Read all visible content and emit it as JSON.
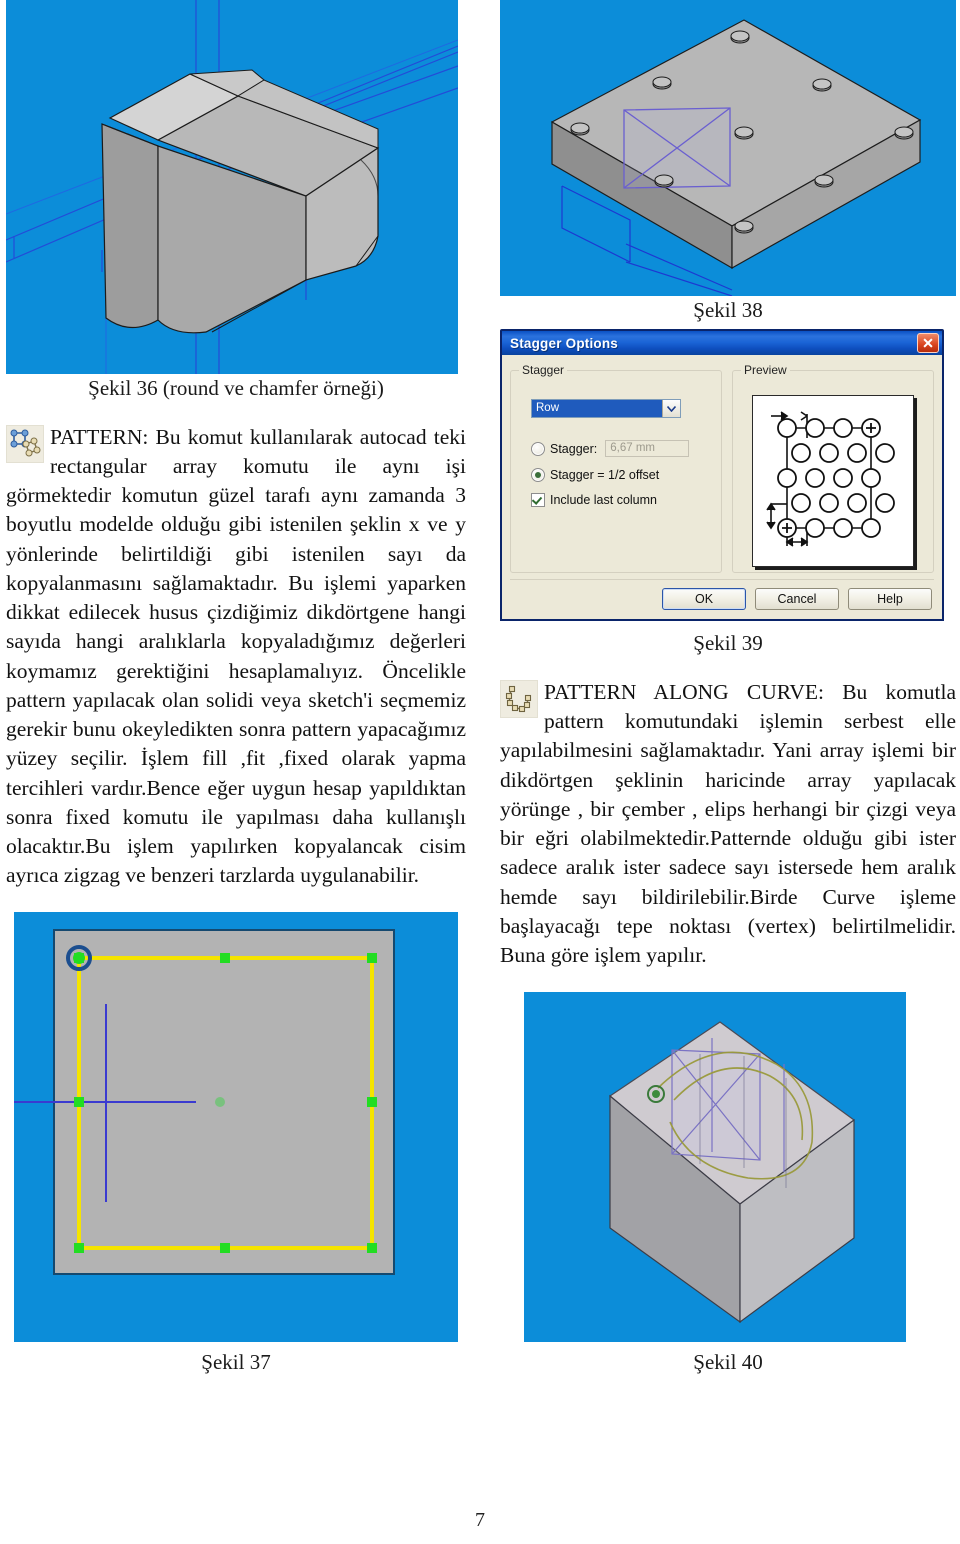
{
  "page": {
    "number": "7"
  },
  "figures": {
    "fig36": {
      "caption": "Şekil 36 (round ve chamfer örneği)",
      "alt": "3B katı model - round ve chamfer uygulanmış küp"
    },
    "fig37": {
      "caption": "Şekil 37",
      "alt": "Sketch düzlemi üzerinde seçili sarı dikdörtgen ve yeşil tutamaklar"
    },
    "fig38": {
      "caption": "Şekil 38",
      "alt": "Delikleri pattern ile çoğaltılmış plaka"
    },
    "fig39": {
      "caption": "Şekil 39",
      "alt": "Stagger Options iletişim kutusu"
    },
    "fig40": {
      "caption": "Şekil 40",
      "alt": "Eğri boyunca pattern uygulanmış prizma"
    }
  },
  "left_column": {
    "icon_name": "pattern-icon",
    "paragraph": "PATTERN: Bu komut kullanılarak autocad teki rectangular array komutu ile aynı işi görmektedir komutun güzel tarafı aynı zamanda 3 boyutlu modelde olduğu gibi istenilen şeklin x ve y yönlerinde belirtildiği gibi istenilen sayı da kopyalanmasını sağlamaktadır. Bu işlemi yaparken dikkat edilecek husus çizdiğimiz dikdörtgene hangi sayıda hangi aralıklarla kopyaladığımız değerleri koymamız gerektiğini hesaplamalıyız. Öncelikle pattern yapılacak olan solidi veya sketch'i seçmemiz gerekir bunu okeyledikten sonra pattern yapacağımız yüzey seçilir. İşlem fill ,fit ,fixed olarak yapma tercihleri vardır.Bence eğer uygun hesap yapıldıktan sonra fixed komutu ile yapılması daha kullanışlı olacaktır.Bu işlem yapılırken kopyalancak cisim ayrıca zigzag ve benzeri tarzlarda uygulanabilir."
  },
  "right_column": {
    "icon_name": "pattern-along-curve-icon",
    "paragraph": "PATTERN ALONG CURVE: Bu komutla pattern komutundaki işlemin serbest elle yapılabilmesini sağlamaktadır. Yani array işlemi bir dikdörtgen şeklinin haricinde array yapılacak yörünge , bir çember , elips herhangi bir çizgi veya bir eğri olabilmektedir.Patternde olduğu gibi ister sadece aralık ister sadece sayı istersede hem aralık hemde sayı bildirilebilir.Birde Curve işleme başlayacağı tepe noktası (vertex) belirtilmelidir. Buna göre işlem yapılır."
  },
  "dialog": {
    "title": "Stagger Options",
    "close_label": "×",
    "groups": {
      "stagger": {
        "legend": "Stagger",
        "combo": {
          "value": "Row"
        },
        "stagger_value_radio": {
          "label": "Stagger:",
          "checked": false
        },
        "stagger_value_field": {
          "value": "6,67 mm"
        },
        "half_offset_radio": {
          "label": "Stagger = 1/2 offset",
          "checked": true
        },
        "include_last_column": {
          "label": "Include last column",
          "checked": true
        }
      },
      "preview": {
        "legend": "Preview"
      }
    },
    "buttons": {
      "ok": "OK",
      "cancel": "Cancel",
      "help": "Help"
    }
  },
  "colors": {
    "cad_background": "#0c8dd9",
    "title_bar": "#1a64d6",
    "dialog_face": "#ece9d8",
    "selection_blue": "#1f5bbd",
    "sketch_yellow": "#f5e400",
    "handle_green": "#22dd22"
  }
}
